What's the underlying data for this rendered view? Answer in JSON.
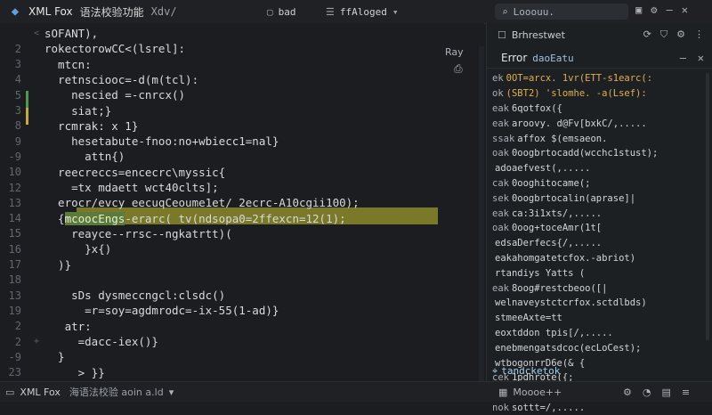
{
  "titlebar": {
    "app_name": "XML Fox",
    "app_subtitle": "语法校验功能",
    "path": "Xdv/",
    "tab1": "bad",
    "tab2": "ffAloged",
    "search_placeholder": "Looouu."
  },
  "editor": {
    "lines": [
      {
        "n": "",
        "text": "sOFANT),",
        "fold": "<"
      },
      {
        "n": "2",
        "text": "rokectorowCC<(lsrel]:",
        "fold": ""
      },
      {
        "n": "3",
        "text": "  mtcn:",
        "fold": ""
      },
      {
        "n": "4",
        "text": "  retnsciooc=-d(m(tcl):",
        "fold": ""
      },
      {
        "n": "5",
        "text": "    nescied =-cnrcx()",
        "fold": ""
      },
      {
        "n": "3",
        "text": "    siat;}",
        "fold": ""
      },
      {
        "n": "8",
        "text": "  rcmrak: x 1}",
        "fold": ""
      },
      {
        "n": "9",
        "text": "    hesetabute-fnoo:no+wbiecc1=nal}",
        "fold": ""
      },
      {
        "n": "-9",
        "text": "      attn{)",
        "fold": ""
      },
      {
        "n": "10",
        "text": "  reecreccs=encecrc\\myssic{",
        "fold": ""
      },
      {
        "n": "12",
        "text": "    =tx mdaett wct40clts];",
        "fold": ""
      },
      {
        "n": "13",
        "text": "  erocr/evcy eecuqCeoume1et/ 2ecrc-A10cgii100);",
        "fold": ""
      },
      {
        "n": "14",
        "text": "  {mcoocEngs-erarc( tv(ndsopa0=2ffexcn=12(1);",
        "fold": ""
      },
      {
        "n": "15",
        "text": "    reayce--rrsc--ngkatrtt)(",
        "fold": ""
      },
      {
        "n": "16",
        "text": "      }x{)",
        "fold": ""
      },
      {
        "n": "17",
        "text": "  )}",
        "fold": ""
      },
      {
        "n": "18",
        "text": "",
        "fold": ""
      },
      {
        "n": "13",
        "text": "    sDs dysmeccngcl:clsdc()",
        "fold": ""
      },
      {
        "n": "19",
        "text": "      =r=soy=agdmrodc=-ix-55(1-ad)}",
        "fold": ""
      },
      {
        "n": "2",
        "text": "   atr:",
        "fold": ""
      },
      {
        "n": "2",
        "text": "     =dacc-iex()}",
        "fold": "+"
      },
      {
        "n": "-9",
        "text": "  }",
        "fold": ""
      },
      {
        "n": "23",
        "text": "     > }}",
        "fold": ""
      }
    ],
    "highlight_token": "mcoocEngs",
    "side_label": "Ray"
  },
  "right_panel": {
    "top_label": "Brhrestwet",
    "error_title": "Error",
    "error_sub": "daoEatu",
    "rows": [
      {
        "k": "ek",
        "text": "0OT=arcx. 1vr(ETT-s1earc(:",
        "warn": true
      },
      {
        "k": "ok",
        "text": "(SBT2) 'slomhe.  -a(Lsef):",
        "warn": true
      },
      {
        "k": "eak",
        "text": "6qotfox({",
        "warn": false
      },
      {
        "k": "eak",
        "text": "aroovy. d@Fv[bxkC/,.....",
        "warn": false
      },
      {
        "k": "ssak",
        "text": "affox $(emsaeon.",
        "warn": false
      },
      {
        "k": "oak",
        "text": "0oogbrtocadd(wcchc1stust);",
        "warn": false
      },
      {
        "k": "",
        "text": " adoaefvest(,.....",
        "warn": false
      },
      {
        "k": "cak",
        "text": "0ooghitocame(;",
        "warn": false
      },
      {
        "k": "sek",
        "text": "0oogbrtocalin(aprase]|",
        "warn": false
      },
      {
        "k": "eak",
        "text": "ca:3i1xts/,.....",
        "warn": false
      },
      {
        "k": "oak",
        "text": "0oog+toceAmr(1t[",
        "warn": false
      },
      {
        "k": "",
        "text": "edsaDerfecs{/,.....",
        "warn": false
      },
      {
        "k": "",
        "text": "eakahomgatetcfox.-abriot)",
        "warn": false
      },
      {
        "k": "",
        "text": "rtandiys Yatts (",
        "warn": false
      },
      {
        "k": "eak",
        "text": "8oog#restcbeoo([|",
        "warn": false
      },
      {
        "k": "",
        "text": "welnaveystctcrfox.sctdlbds)",
        "warn": false
      },
      {
        "k": "",
        "text": "stmeeAxte=tt",
        "warn": false
      },
      {
        "k": "",
        "text": "eoxtddon tpis[/,.....",
        "warn": false
      },
      {
        "k": "",
        "text": "enebmengatsdcoc(ecLoCest);",
        "warn": false
      },
      {
        "k": "",
        "text": "wtbogonrrD6e(& {",
        "warn": false
      },
      {
        "k": "cek",
        "text": "1pdhrote({;",
        "warn": false
      },
      {
        "k": "cek",
        "text": "dFFEX 56T5/,.....",
        "warn": false
      },
      {
        "k": "nok",
        "text": "sottt=/,.....",
        "warn": false
      }
    ],
    "bottom_label": "tandcketok"
  },
  "statusbar": {
    "app": "XML Fox",
    "sub": "海语法校验 aoin a.ld",
    "mid": "Moooe++"
  },
  "colors": {
    "highlight_yellow": "#8a8a2a",
    "highlight_green": "#5c7a3a",
    "warning": "#e0b04a",
    "accent_blue": "#5aa0e6"
  }
}
